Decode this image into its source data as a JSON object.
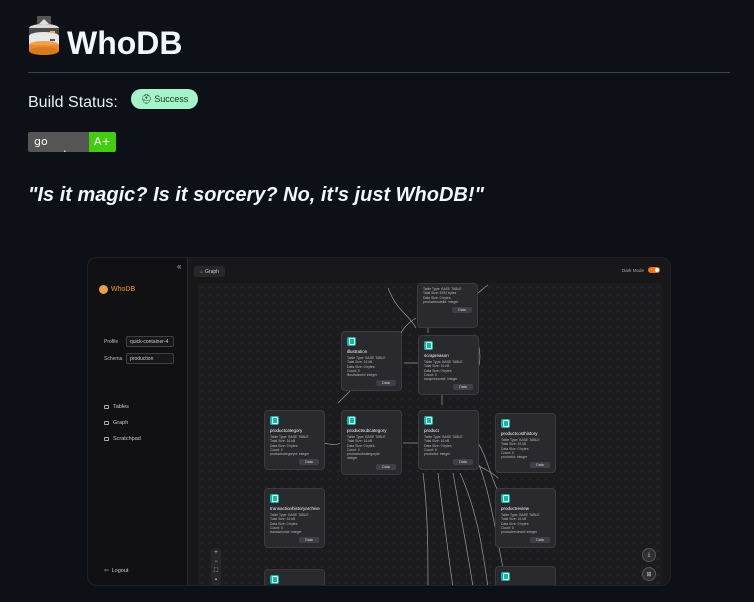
{
  "header": {
    "title": "WhoDB"
  },
  "build": {
    "label": "Build Status:",
    "badge_text": "Success"
  },
  "goreport": {
    "left": "go report",
    "right": "A+"
  },
  "quote": "\"Is it magic? Is it sorcery? No, it's just WhoDB!\"",
  "colors": {
    "success_badge": "#a7f3c9",
    "goreport_grade": "#44cc11",
    "accent": "#f59e0b",
    "node_icon": "#14b8a6"
  },
  "app": {
    "brand": "WhoDB",
    "profile_label": "Profile",
    "profile_value": "quick-container-4",
    "schema_label": "Schema",
    "schema_value": "production",
    "nav": [
      {
        "label": "Tables",
        "icon": "table-icon"
      },
      {
        "label": "Graph",
        "icon": "graph-icon"
      },
      {
        "label": "Scratchpad",
        "icon": "scratchpad-icon"
      }
    ],
    "logout": "Logout",
    "tab": "Graph",
    "dark_mode": "Dark Mode",
    "nodes": [
      {
        "name": "",
        "lines": [
          "Table Type: BASE TABLE",
          "Total Size: 8192 bytes",
          "Data Size: 0 bytes",
          "Count: 0",
          "productmodelid: integer"
        ],
        "data": "Data"
      },
      {
        "name": "illustration",
        "lines": [
          "Table Type: BASE TABLE",
          "Total Size: 16 kB",
          "Data Size: 0 bytes",
          "Count: 0",
          "illustrationid: integer"
        ],
        "data": "Data"
      },
      {
        "name": "scrapreason",
        "lines": [
          "Table Type: BASE TABLE",
          "Total Size: 16 kB",
          "Data Size: 0 bytes",
          "Count: 0",
          "scrapreasonid: integer"
        ],
        "data": "Data"
      },
      {
        "name": "productcategory",
        "lines": [
          "Table Type: BASE TABLE",
          "Total Size: 16 kB",
          "Data Size: 0 bytes",
          "Count: 0",
          "productcategoryid: integer"
        ],
        "data": "Data"
      },
      {
        "name": "productsubcategory",
        "lines": [
          "Table Type: BASE TABLE",
          "Total Size: 16 kB",
          "Data Size: 0 bytes",
          "Count: 0",
          "productsubcategoryid:",
          "integer"
        ],
        "data": "Data"
      },
      {
        "name": "product",
        "lines": [
          "Table Type: BASE TABLE",
          "Total Size: 16 kB",
          "Data Size: 0 bytes",
          "Count: 0",
          "productid: integer"
        ],
        "data": "Data"
      },
      {
        "name": "productcosthistory",
        "lines": [
          "Table Type: BASE TABLE",
          "Total Size: 16 kB",
          "Data Size: 0 bytes",
          "Count: 0",
          "productid: integer"
        ],
        "data": "Data"
      },
      {
        "name": "transactionhistoryarchive",
        "lines": [
          "Table Type: BASE TABLE",
          "Total Size: 16 kB",
          "Data Size: 0 bytes",
          "Count: 0",
          "transactionid: integer"
        ],
        "data": "Data"
      },
      {
        "name": "productreview",
        "lines": [
          "Table Type: BASE TABLE",
          "Total Size: 16 kB",
          "Data Size: 0 bytes",
          "Count: 0",
          "productreviewid: integer"
        ],
        "data": "Data"
      }
    ],
    "zoom_controls": [
      "+",
      "−",
      "⛶",
      "▪"
    ]
  }
}
